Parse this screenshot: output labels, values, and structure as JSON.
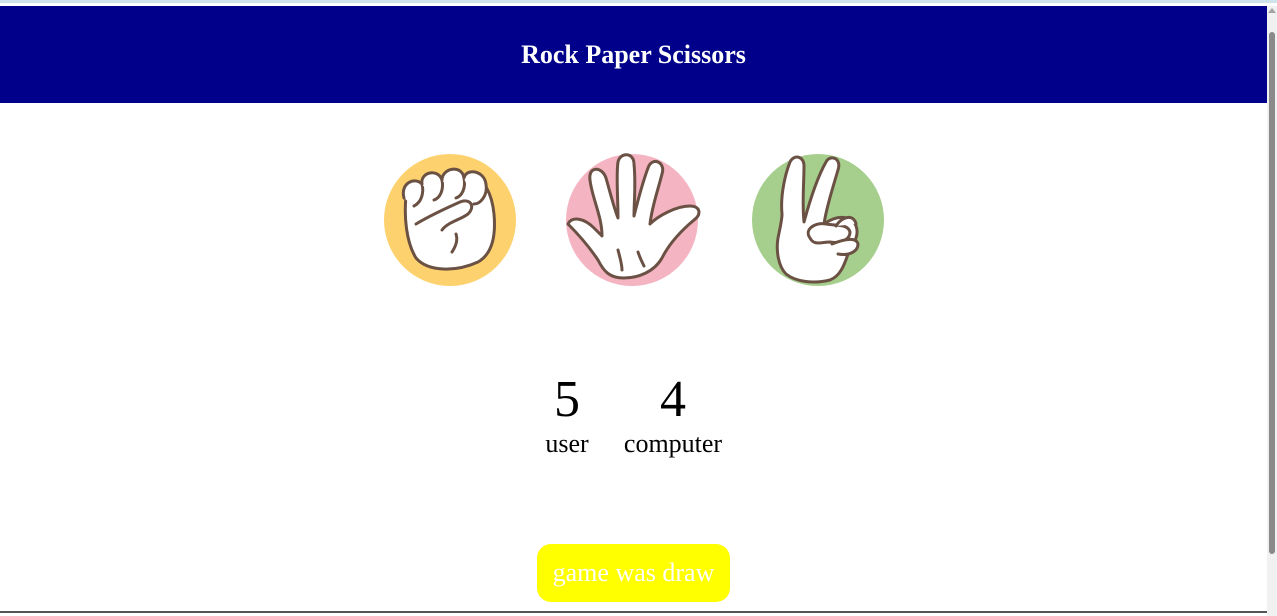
{
  "header": {
    "title": "Rock Paper Scissors"
  },
  "choices": [
    {
      "id": "rock",
      "icon": "fist-icon",
      "color": "#fdd26e"
    },
    {
      "id": "paper",
      "icon": "open-hand-icon",
      "color": "#f4b4c2"
    },
    {
      "id": "scissors",
      "icon": "peace-sign-icon",
      "color": "#a6ce8c"
    }
  ],
  "score": {
    "user": {
      "value": "5",
      "label": "user"
    },
    "computer": {
      "value": "4",
      "label": "computer"
    }
  },
  "result": {
    "message": "game was draw",
    "color": "#ffff00"
  },
  "colors": {
    "header_bg": "#00008b",
    "stroke": "#6b5144"
  }
}
